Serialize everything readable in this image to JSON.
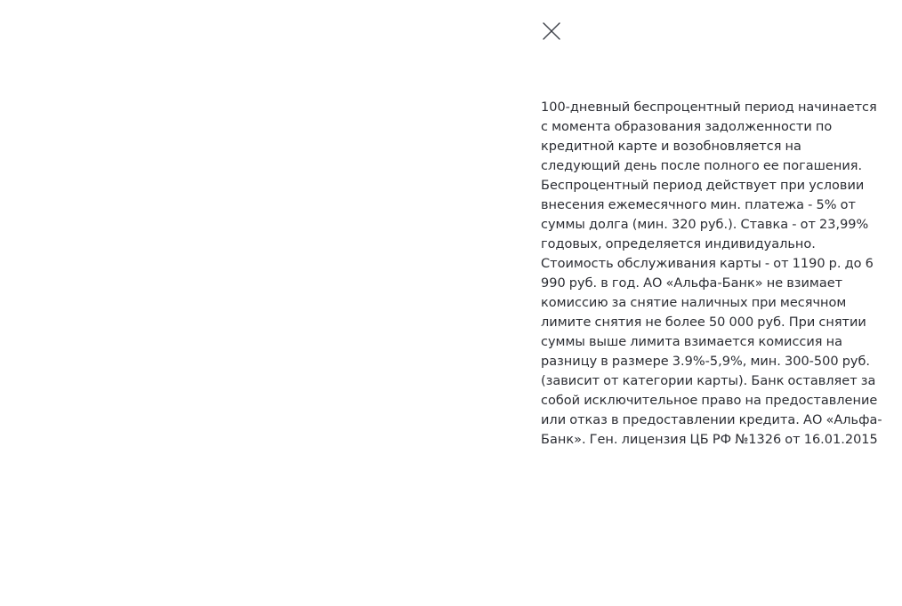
{
  "modal": {
    "close_icon": "close-icon",
    "disclaimer_text": "100-дневный беспроцентный период начинается с момента образования задолженности по кредитной карте и возобновляется на следующий день после полного ее погашения. Беспроцентный период действует при условии внесения ежемесячного мин. платежа - 5% от суммы долга (мин. 320 руб.). Ставка - от 23,99% годовых, определяется индивидуально. Стоимость обслуживания карты - от 1190 р. до 6 990 руб. в год. АО «Альфа-Банк» не взимает комиссию за снятие наличных при месячном лимите снятия не более 50 000 руб. При снятии суммы выше лимита взимается комиссия на разницу в размере 3.9%-5,9%, мин. 300-500 руб. (зависит от категории карты). Банк оставляет за собой исключительное право на предоставление или отказ в предоставлении кредита. АО «Альфа-Банк». Ген. лицензия ЦБ РФ №1326 от 16.01.2015",
    "text_color": "#2b2d33",
    "icon_color": "#3c3f47"
  }
}
